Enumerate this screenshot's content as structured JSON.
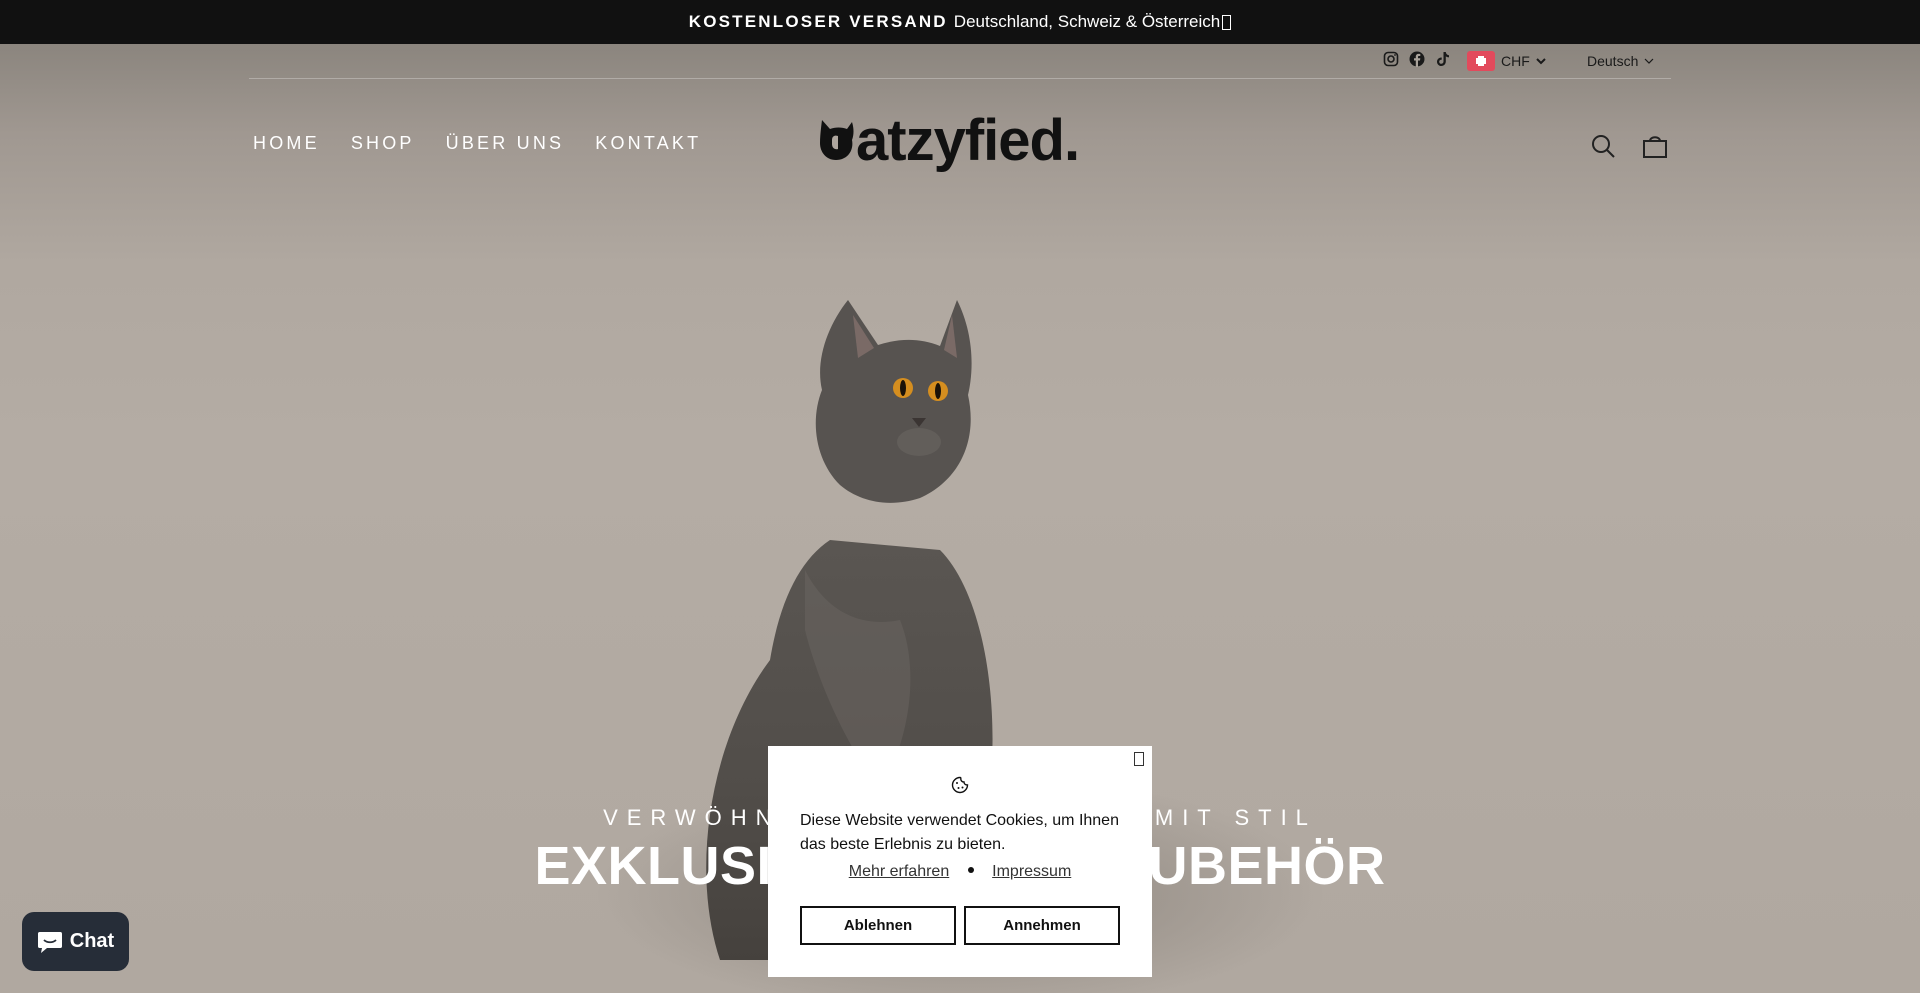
{
  "announcement": {
    "bold": "KOSTENLOSER VERSAND",
    "text": "Deutschland, Schweiz & Österreich"
  },
  "utility": {
    "social": [
      "instagram-icon",
      "facebook-icon",
      "tiktok-icon"
    ],
    "currency": "CHF",
    "language": "Deutsch"
  },
  "nav": {
    "items": [
      "HOME",
      "SHOP",
      "ÜBER UNS",
      "KONTAKT"
    ]
  },
  "logo": {
    "text": "atzyfied."
  },
  "header_icons": [
    "search-icon",
    "cart-icon"
  ],
  "hero": {
    "subtitle": "VERWÖHNEN SIE IHRE KATZE MIT STIL",
    "headline": "EXKLUSIVES KATZENZUBEHÖR"
  },
  "cookie": {
    "message": "Diese Website verwendet Cookies, um Ihnen das beste Erlebnis zu bieten.",
    "link_more": "Mehr erfahren",
    "link_imprint": "Impressum",
    "decline": "Ablehnen",
    "accept": "Annehmen"
  },
  "chat": {
    "label": "Chat"
  },
  "colors": {
    "announce_bg": "#111111",
    "chat_bg": "#262d38",
    "flag": "#e24a5c"
  }
}
